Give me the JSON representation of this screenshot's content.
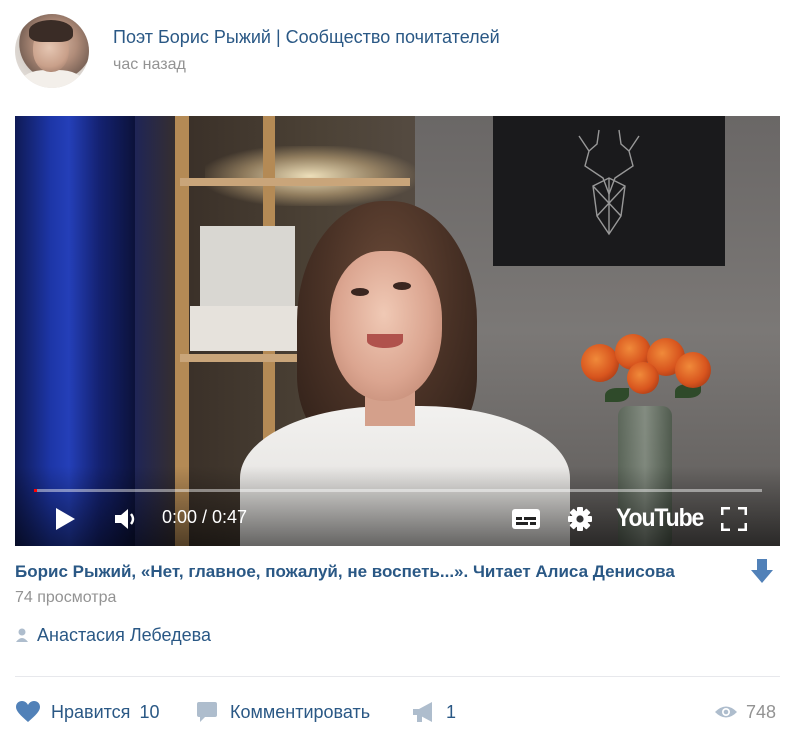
{
  "header": {
    "group_name": "Поэт Борис Рыжий | Сообщество почитателей",
    "time": "час назад"
  },
  "video": {
    "current_time": "0:00",
    "duration": "0:47",
    "time_display": "0:00 / 0:47",
    "progress_fraction": 0.0,
    "platform_logo": "YouTube",
    "icons": [
      "play-icon",
      "volume-icon",
      "subtitles-icon",
      "gear-icon",
      "fullscreen-icon"
    ]
  },
  "post": {
    "video_title": "Борис Рыжий, «Нет, главное, пожалуй, не воспеть...». Читает Алиса Денисова",
    "views": "74 просмотра",
    "author": "Анастасия Лебедева"
  },
  "actions": {
    "like_label": "Нравится",
    "like_count": "10",
    "comment_label": "Комментировать",
    "repost_count": "1",
    "view_count": "748"
  },
  "colors": {
    "link_blue": "#2a5885",
    "muted_gray": "#939393",
    "icon_blue": "#5181b8",
    "icon_gray": "#aebdcd",
    "progress_red": "#ff0000"
  }
}
